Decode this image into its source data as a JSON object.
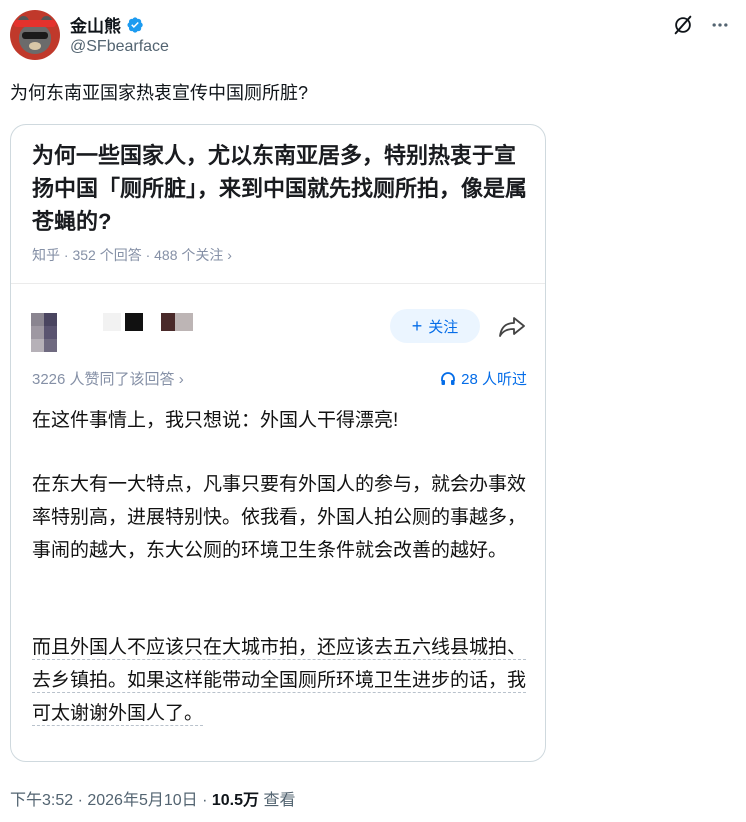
{
  "author": {
    "display_name": "金山熊",
    "handle": "@SFbearface",
    "avatar_icon": "bear-avatar-icon",
    "verified_color": "#1d9bf0"
  },
  "top_actions": {
    "grok_icon": "grok-icon",
    "more_icon": "more-icon"
  },
  "tweet": {
    "text": "为何东南亚国家热衷宣传中国厕所脏?"
  },
  "card": {
    "question_title": "为何一些国家人，尤以东南亚居多，特别热衷于宣扬中国「厕所脏」，来到中国就先找厕所拍，像是属苍蝇的?",
    "meta": "知乎 · 352 个回答 · 488 个关注 ›",
    "follow_label": "关注",
    "likes_text": "3226 人赞同了该回答 ›",
    "listen_text": "28 人听过",
    "paragraphs": [
      "在这件事情上，我只想说：外国人干得漂亮!",
      "在东大有一大特点，凡事只要有外国人的参与，就会办事效率特别高，进展特别快。依我看，外国人拍公厕的事越多，事闹的越大，东大公厕的环境卫生条件就会改善的越好。",
      "而且外国人不应该只在大城市拍，还应该去五六线县城拍、去乡镇拍。如果这样能带动全国厕所环境卫生进步的话，我可太谢谢外国人了。"
    ],
    "accent_color": "#056de8"
  },
  "footer": {
    "time": "下午3:52 · 2026年5月10日 · ",
    "views": "10.5万",
    "views_label": " 查看"
  }
}
